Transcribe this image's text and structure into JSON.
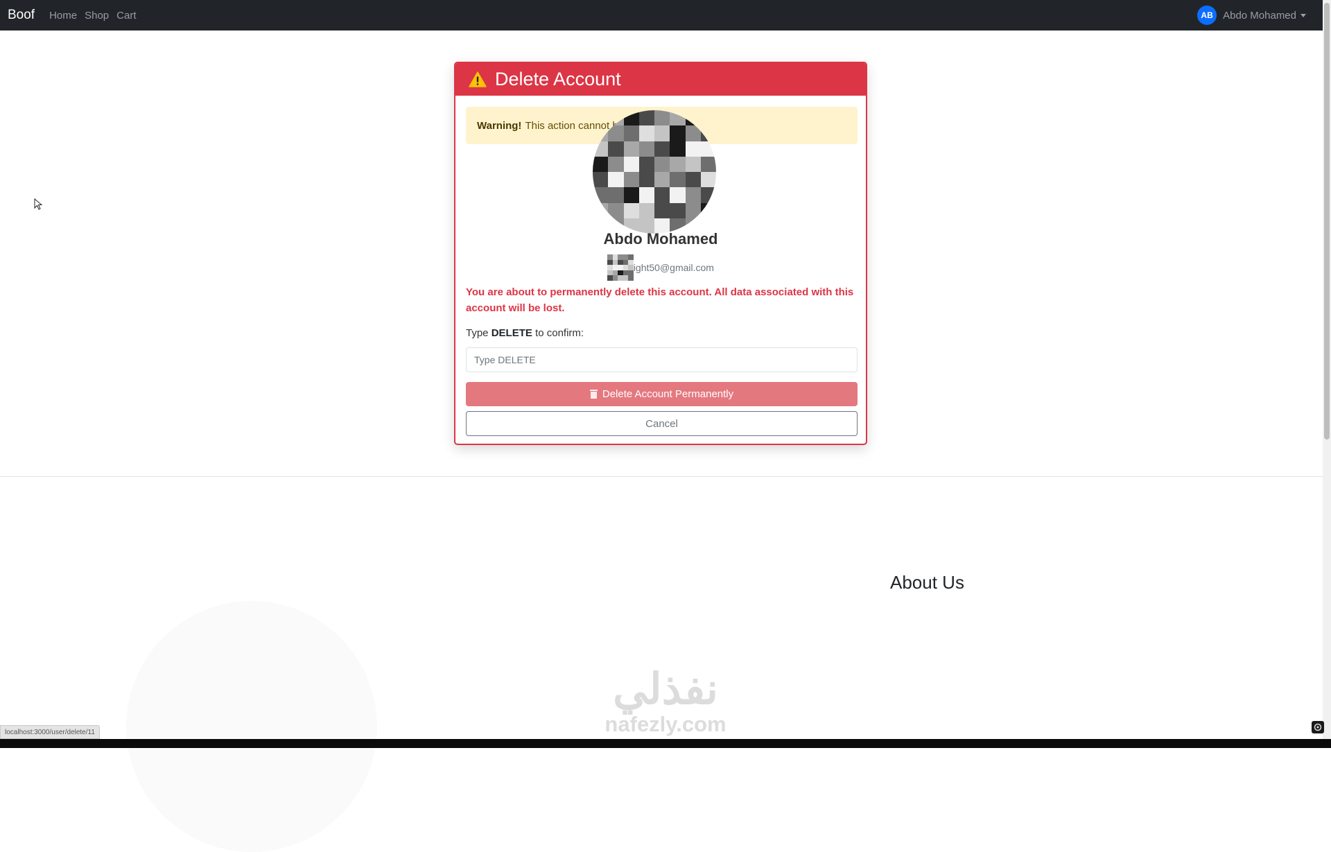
{
  "navbar": {
    "brand": "Boof",
    "links": [
      "Home",
      "Shop",
      "Cart"
    ],
    "user": {
      "initials": "AB",
      "name": "Abdo Mohamed"
    }
  },
  "card": {
    "title": "Delete Account",
    "alert": {
      "strong": "Warning!",
      "text": "This action cannot b"
    },
    "profile": {
      "name": "Abdo Mohamed",
      "email": "night50@gmail.com"
    },
    "danger_text": "You are about to permanently delete this account. All data associated with this account will be lost.",
    "confirm": {
      "prefix": "Type",
      "keyword": "DELETE",
      "suffix": "to confirm:",
      "placeholder": "Type DELETE"
    },
    "delete_button": "Delete Account Permanently",
    "cancel_button": "Cancel"
  },
  "footer": {
    "about_title": "About Us"
  },
  "watermark": {
    "arabic": "نفذلي",
    "latin": "nafezly.com"
  },
  "status_bar": {
    "url": "localhost:3000/user/delete/11"
  },
  "colors": {
    "danger": "#dc3545",
    "warning_bg": "#fff3cd",
    "navbar": "#212529",
    "primary": "#0d6efd"
  }
}
